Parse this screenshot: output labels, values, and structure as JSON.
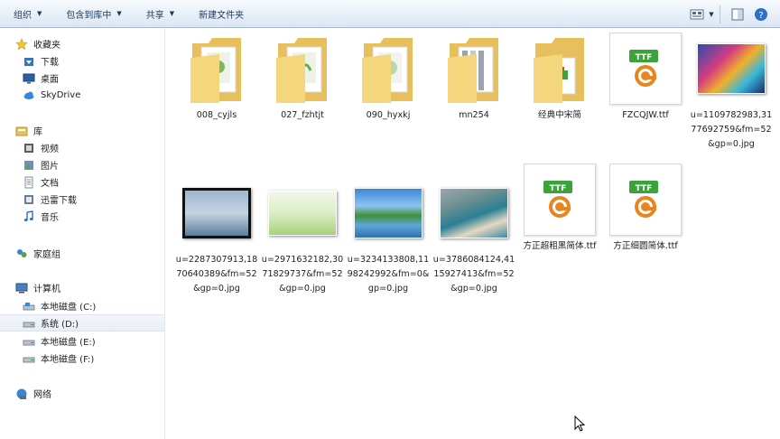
{
  "toolbar": {
    "organize": "组织",
    "include_in_library": "包含到库中",
    "share": "共享",
    "new_folder": "新建文件夹"
  },
  "nav": {
    "favorites": "收藏夹",
    "downloads": "下载",
    "desktop": "桌面",
    "skydrive": "SkyDrive",
    "libraries": "库",
    "videos": "视频",
    "pictures": "图片",
    "documents": "文档",
    "xunlei": "迅雷下载",
    "music": "音乐",
    "homegroup": "家庭组",
    "computer": "计算机",
    "drive_c": "本地磁盘 (C:)",
    "drive_d": "系统 (D:)",
    "drive_e": "本地磁盘 (E:)",
    "drive_f": "本地磁盘 (F:)",
    "network": "网络"
  },
  "files": {
    "f0": "008_cyjls",
    "f1": "027_fzhtjt",
    "f2": "090_hyxkj",
    "f3": "mn254",
    "f4": "经典中宋简",
    "f5": "FZCQJW.ttf",
    "f6": "u=1109782983,3177692759&fm=52&gp=0.jpg",
    "f7": "u=2287307913,1870640389&fm=52&gp=0.jpg",
    "f8": "u=2971632182,3071829737&fm=52&gp=0.jpg",
    "f9": "u=3234133808,1198242992&fm=0&gp=0.jpg",
    "f10": "u=3786084124,4115927413&fm=52&gp=0.jpg",
    "f11": "方正超粗黑简体.ttf",
    "f12": "方正细圆简体.ttf"
  },
  "ttf_badge": "TTF",
  "icons": {
    "toolbar_view": "view-icon",
    "toolbar_preview": "preview-pane-icon",
    "toolbar_help": "help-icon",
    "folder": "folder-icon",
    "font_file": "ttf-file-icon",
    "image_file": "image-thumbnail-icon"
  },
  "colors": {
    "toolbar_text": "#1e395b",
    "folder": "#f2cf6a",
    "ttf_green": "#3aa43a",
    "ttf_orange": "#e8851f"
  }
}
